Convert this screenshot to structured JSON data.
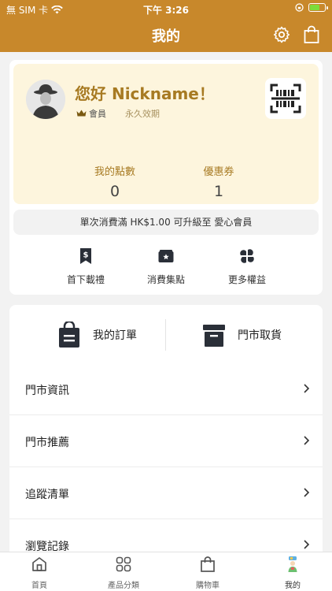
{
  "status_bar": {
    "carrier": "無 SIM 卡",
    "time": "下午 3:26"
  },
  "header": {
    "title": "我的",
    "settings_icon": "gear-icon",
    "bag_icon": "shopping-bag-icon"
  },
  "member": {
    "greeting": "您好 Nickname！",
    "tier_label": "會員",
    "validity": "永久效期",
    "stats": {
      "points_label": "我的點數",
      "points_value": "0",
      "coupons_label": "優惠券",
      "coupons_value": "1"
    },
    "upgrade_text": "單次消費滿 HK$1.00 可升級至 愛心會員"
  },
  "perks": [
    {
      "label": "首下載禮",
      "icon": "dollar-bookmark-icon"
    },
    {
      "label": "消費集點",
      "icon": "star-card-icon"
    },
    {
      "label": "更多權益",
      "icon": "clover-icon"
    }
  ],
  "orders": {
    "my_orders_label": "我的訂單",
    "store_pickup_label": "門市取貨"
  },
  "menu": [
    {
      "label": "門市資訊"
    },
    {
      "label": "門市推薦"
    },
    {
      "label": "追蹤清單"
    },
    {
      "label": "瀏覽記錄"
    }
  ],
  "tabs": [
    {
      "label": "首頁",
      "icon": "home-icon"
    },
    {
      "label": "產品分類",
      "icon": "grid-icon"
    },
    {
      "label": "購物車",
      "icon": "cart-bag-icon"
    },
    {
      "label": "我的",
      "icon": "profile-icon"
    }
  ],
  "colors": {
    "brand": "#c8882b",
    "card_bg": "#fdf5dd",
    "accent_text": "#a77a22"
  }
}
